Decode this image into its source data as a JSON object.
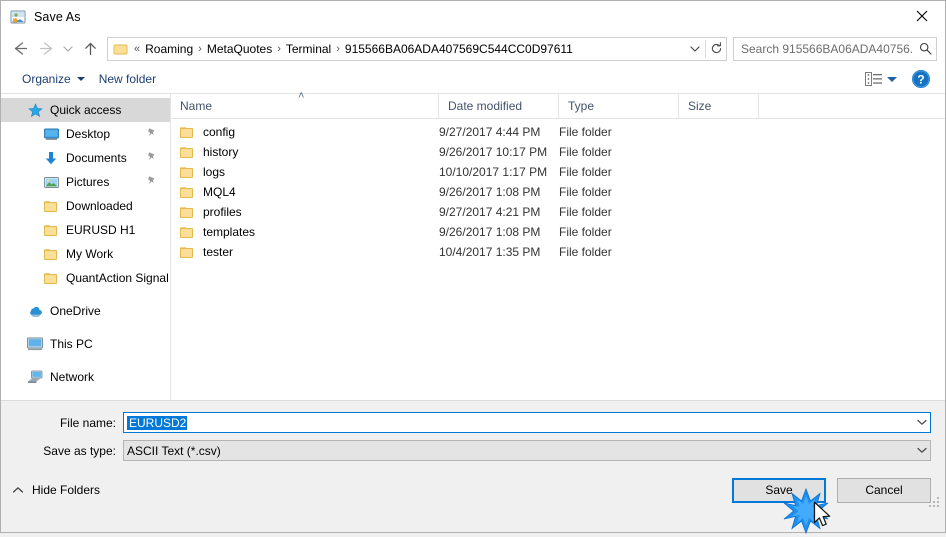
{
  "window": {
    "title": "Save As",
    "title_icon": "save-as-icon",
    "close_label": "✕"
  },
  "navigation": {
    "back_icon": "back-arrow-icon",
    "forward_icon": "forward-arrow-icon",
    "recent_icon": "recent-locations-chevron-icon",
    "up_icon": "up-arrow-icon",
    "address": {
      "folder_icon": "folder-icon",
      "overflow": "«",
      "crumbs": [
        "Roaming",
        "MetaQuotes",
        "Terminal",
        "915566BA06ADA407569C544CC0D97611"
      ],
      "separator": "›",
      "dropdown_icon": "chevron-down-icon",
      "refresh_icon": "refresh-icon"
    },
    "search": {
      "placeholder": "Search 915566BA06ADA40756...",
      "icon": "search-icon"
    }
  },
  "toolbar": {
    "organize_label": "Organize",
    "new_folder_label": "New folder",
    "view_icon": "view-mode-icon",
    "view_chevron_icon": "chevron-down-icon",
    "help_icon": "help-icon",
    "help_label": "?"
  },
  "sidebar": {
    "items": [
      {
        "label": "Quick access",
        "icon": "star-icon",
        "indent": 0,
        "selected": true,
        "pinned": false
      },
      {
        "label": "Desktop",
        "icon": "desktop-icon",
        "indent": 1,
        "selected": false,
        "pinned": true
      },
      {
        "label": "Documents",
        "icon": "documents-download-icon",
        "indent": 1,
        "selected": false,
        "pinned": true
      },
      {
        "label": "Pictures",
        "icon": "pictures-icon",
        "indent": 1,
        "selected": false,
        "pinned": true
      },
      {
        "label": "Downloaded",
        "icon": "folder-icon",
        "indent": 1,
        "selected": false,
        "pinned": false
      },
      {
        "label": "EURUSD H1",
        "icon": "folder-icon",
        "indent": 1,
        "selected": false,
        "pinned": false
      },
      {
        "label": "My Work",
        "icon": "folder-icon",
        "indent": 1,
        "selected": false,
        "pinned": false
      },
      {
        "label": "QuantAction Signal",
        "icon": "folder-icon",
        "indent": 1,
        "selected": false,
        "pinned": false
      },
      {
        "label": "OneDrive",
        "icon": "onedrive-icon",
        "indent": 0,
        "selected": false,
        "pinned": false,
        "gap_before": true
      },
      {
        "label": "This PC",
        "icon": "this-pc-icon",
        "indent": 0,
        "selected": false,
        "pinned": false,
        "gap_before": true
      },
      {
        "label": "Network",
        "icon": "network-icon",
        "indent": 0,
        "selected": false,
        "pinned": false,
        "gap_before": true
      }
    ]
  },
  "filelist": {
    "columns": [
      "Name",
      "Date modified",
      "Type",
      "Size"
    ],
    "sort_column": "Name",
    "sort_direction": "ascending",
    "sort_caret": "˄",
    "rows": [
      {
        "name": "config",
        "date": "9/27/2017 4:44 PM",
        "type": "File folder",
        "size": "",
        "icon": "folder-icon"
      },
      {
        "name": "history",
        "date": "9/26/2017 10:17 PM",
        "type": "File folder",
        "size": "",
        "icon": "folder-icon"
      },
      {
        "name": "logs",
        "date": "10/10/2017 1:17 PM",
        "type": "File folder",
        "size": "",
        "icon": "folder-icon"
      },
      {
        "name": "MQL4",
        "date": "9/26/2017 1:08 PM",
        "type": "File folder",
        "size": "",
        "icon": "folder-icon"
      },
      {
        "name": "profiles",
        "date": "9/27/2017 4:21 PM",
        "type": "File folder",
        "size": "",
        "icon": "folder-icon"
      },
      {
        "name": "templates",
        "date": "9/26/2017 1:08 PM",
        "type": "File folder",
        "size": "",
        "icon": "folder-icon"
      },
      {
        "name": "tester",
        "date": "10/4/2017 1:35 PM",
        "type": "File folder",
        "size": "",
        "icon": "folder-icon"
      }
    ]
  },
  "form": {
    "filename_label": "File name:",
    "filename_value": "EURUSD2",
    "filename_selected": true,
    "filetype_label": "Save as type:",
    "filetype_value": "ASCII Text (*.csv)",
    "dropdown_icon": "chevron-down-icon"
  },
  "footer": {
    "hide_folders_label": "Hide Folders",
    "hide_folders_icon": "chevron-up-icon",
    "save_label": "Save",
    "cancel_label": "Cancel",
    "resize_grip_icon": "resize-grip-icon",
    "click_burst_icon": "click-burst-icon",
    "cursor_icon": "mouse-pointer-icon"
  },
  "colors": {
    "accent": "#0078d7",
    "toolbar_text": "#1c3f74",
    "header_text": "#43536b",
    "selection": "#d8d8d8",
    "folder": "#fbdf97"
  }
}
